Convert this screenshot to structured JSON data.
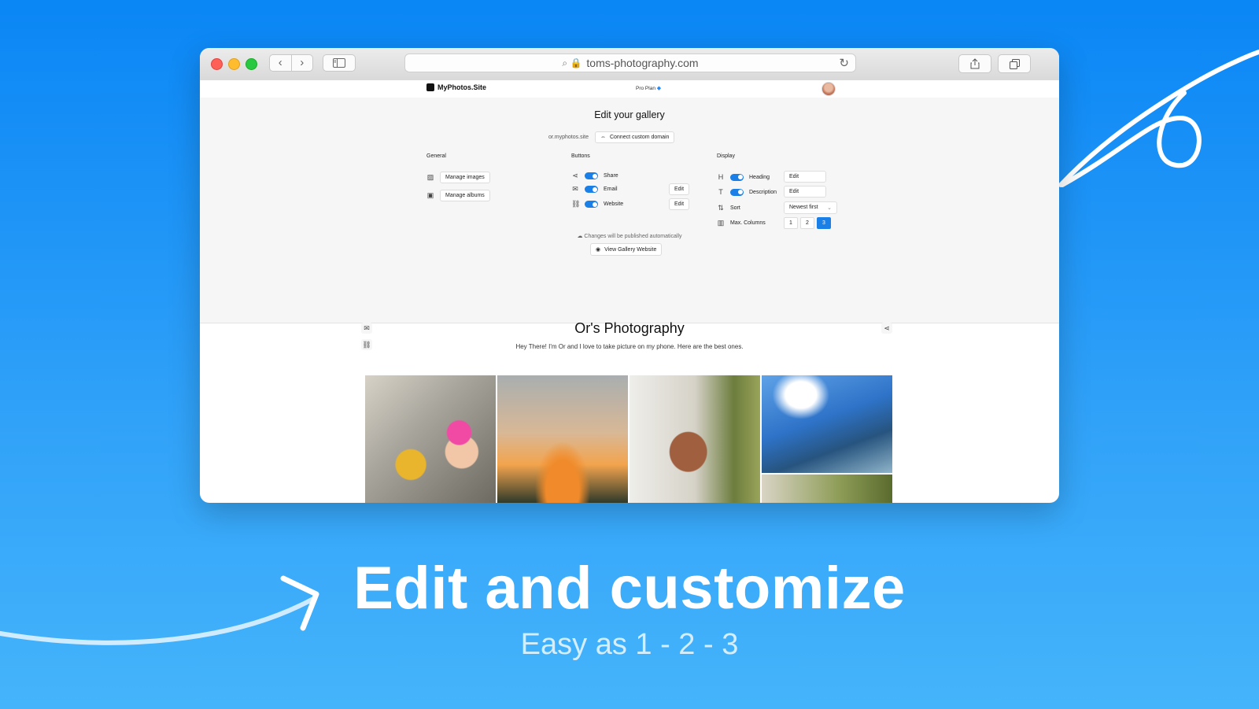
{
  "colors": {
    "accent": "#1a7fe6",
    "background_top": "#0a86f5",
    "background_bottom": "#45b4fb"
  },
  "browser": {
    "url": "toms-photography.com",
    "icons": {
      "back": "chevron-left-icon",
      "forward": "chevron-right-icon",
      "sidebar": "sidebar-icon",
      "share": "share-icon",
      "tabs": "tabs-icon",
      "reload": "reload-icon"
    }
  },
  "app_header": {
    "brand": "MyPhotos.Site",
    "plan": "Pro Plan"
  },
  "editor": {
    "title": "Edit your gallery",
    "subdomain": "or.myphotos.site",
    "connect_domain_label": "Connect custom domain",
    "general": {
      "heading": "General",
      "items": [
        {
          "label": "Manage images"
        },
        {
          "label": "Manage albums"
        }
      ]
    },
    "buttons": {
      "heading": "Buttons",
      "items": [
        {
          "label": "Share",
          "enabled": true
        },
        {
          "label": "Email",
          "enabled": true,
          "edit_label": "Edit"
        },
        {
          "label": "Website",
          "enabled": true,
          "edit_label": "Edit"
        }
      ]
    },
    "display": {
      "heading": "Display",
      "heading_label": "Heading",
      "heading_field": "Edit",
      "description_label": "Description",
      "description_field": "Edit",
      "sort_label": "Sort",
      "sort_value": "Newest first",
      "columns_label": "Max. Columns",
      "columns_options": [
        "1",
        "2",
        "3"
      ],
      "columns_selected": "3"
    },
    "publish_note": "Changes will be published automatically",
    "view_gallery_label": "View Gallery Website"
  },
  "gallery": {
    "title": "Or's Photography",
    "description": "Hey There! I'm Or and I love to take picture on my phone. Here are the best ones."
  },
  "marketing": {
    "headline": "Edit and customize",
    "subline": "Easy as 1 - 2 - 3"
  }
}
